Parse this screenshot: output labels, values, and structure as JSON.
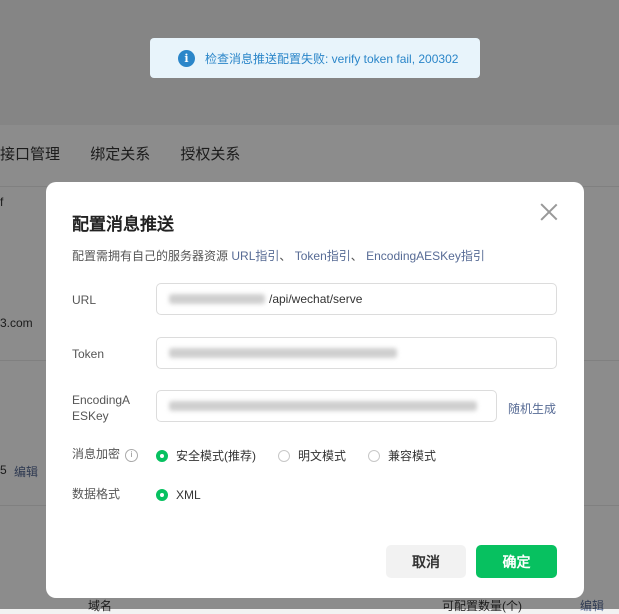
{
  "background": {
    "tabs": [
      "接口管理",
      "绑定关系",
      "授权关系"
    ],
    "frag_f": "f",
    "frag_domain": "3.com",
    "frag_num": "5",
    "edit_link": "编辑",
    "bottom_name": "域名",
    "bottom_count": "可配置数量(个)",
    "bottom_edit": "编辑"
  },
  "toast": {
    "text": "检查消息推送配置失败: verify token fail, 200302"
  },
  "dialog": {
    "title": "配置消息推送",
    "desc_prefix": "配置需拥有自己的服务器资源",
    "link_url": "URL指引",
    "link_token": "Token指引",
    "link_aes": "EncodingAESKey指引",
    "sep": "、",
    "url_label": "URL",
    "url_value": "/api/wechat/serve",
    "token_label": "Token",
    "aes_label_1": "EncodingA",
    "aes_label_2": "ESKey",
    "random_link": "随机生成",
    "encrypt_label": "消息加密",
    "encrypt_options": [
      "安全模式(推荐)",
      "明文模式",
      "兼容模式"
    ],
    "format_label": "数据格式",
    "format_options": [
      "XML"
    ],
    "cancel": "取消",
    "ok": "确定"
  },
  "colors": {
    "primary": "#07c160",
    "link": "#576b95",
    "info": "#2b86c9"
  }
}
